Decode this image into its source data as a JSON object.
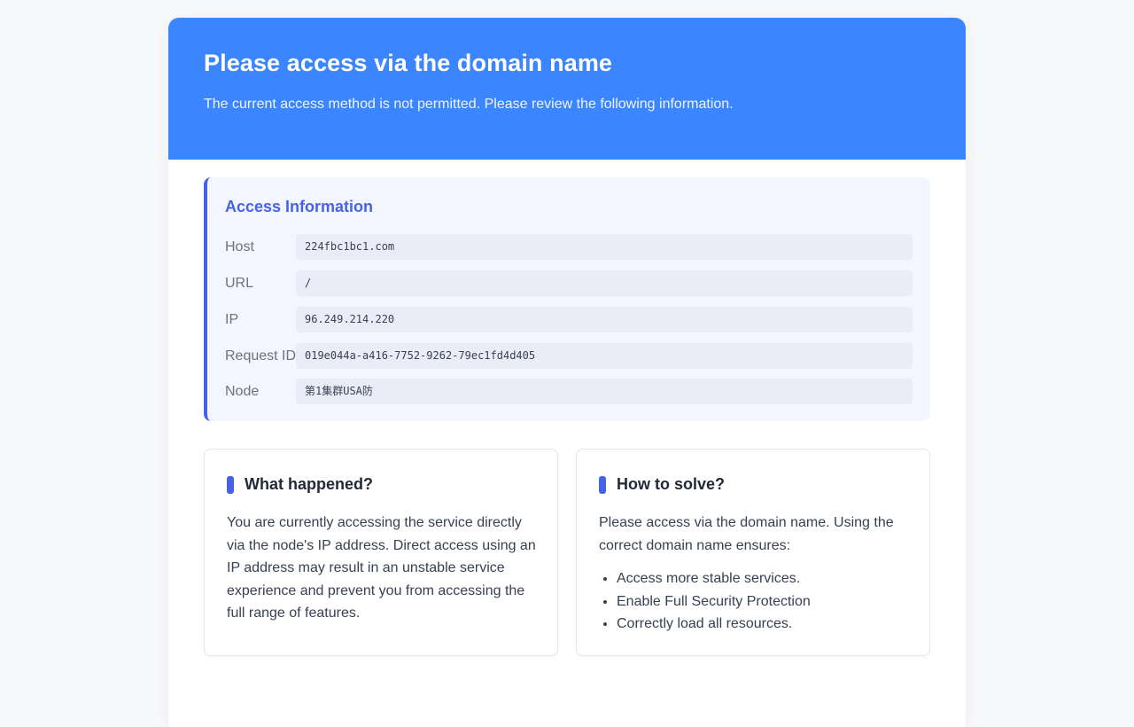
{
  "header": {
    "title": "Please access via the domain name",
    "subtitle": "The current access method is not permitted. Please review the following information."
  },
  "access_info": {
    "title": "Access Information",
    "rows": [
      {
        "label": "Host",
        "value": "224fbc1bc1.com"
      },
      {
        "label": "URL",
        "value": "/"
      },
      {
        "label": "IP",
        "value": "96.249.214.220"
      },
      {
        "label": "Request ID",
        "value": "019e044a-a416-7752-9262-79ec1fd4d405"
      },
      {
        "label": "Node",
        "value": "第1集群USA防"
      }
    ]
  },
  "what_happened": {
    "title": "What happened?",
    "text": "You are currently accessing the service directly via the node's IP address. Direct access using an IP address may result in an unstable service experience and prevent you from accessing the full range of features."
  },
  "how_to_solve": {
    "title": "How to solve?",
    "text": "Please access via the domain name. Using the correct domain name ensures:",
    "items": [
      "Access more stable services.",
      "Enable Full Security Protection",
      "Correctly load all resources."
    ]
  },
  "colors": {
    "header_bg": "#3b86ff",
    "accent": "#4663e6",
    "info_bg": "#f3f6fe"
  }
}
